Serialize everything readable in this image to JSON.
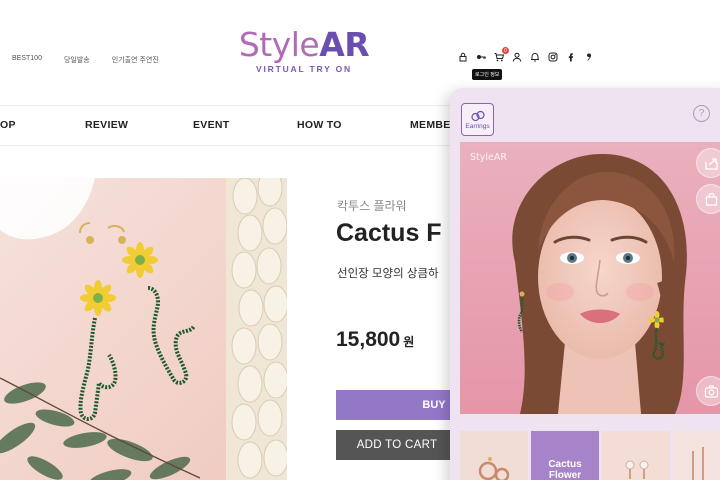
{
  "header": {
    "top_links": [
      "BEST100",
      "당일발송",
      "인기출연 주연진"
    ],
    "logo": {
      "main_part1": "Style",
      "main_part2": "AR",
      "sub": "VIRTUAL TRY ON"
    },
    "icons": [
      "lock-icon",
      "key-icon",
      "cart-icon",
      "user-icon",
      "bell-icon",
      "instagram-icon",
      "facebook-icon",
      "kakao-icon"
    ],
    "cart_count": "0",
    "tooltip": "로그인 정보"
  },
  "nav": {
    "items": [
      "OP",
      "REVIEW",
      "EVENT",
      "HOW TO",
      "MEMBERS"
    ]
  },
  "product": {
    "korean_name": "칵투스 플라워",
    "title": "Cactus F",
    "description": "선인장 모양의 상큼하",
    "price": "15,800",
    "currency": "원",
    "buy_label": "BUY",
    "cart_label": "ADD TO CART"
  },
  "ar_panel": {
    "tab_label": "Earrings",
    "help": "?",
    "watermark": "StyleAR",
    "thumbnails": [
      {
        "label": ""
      },
      {
        "label": "Cactus Flower"
      },
      {
        "label": ""
      },
      {
        "label": ""
      }
    ]
  },
  "colors": {
    "brand_purple": "#6a4fb0",
    "buy_button": "#9478c8",
    "cart_button": "#555555",
    "panel_bg": "#efe3f2",
    "active_thumb": "#a784c9"
  }
}
